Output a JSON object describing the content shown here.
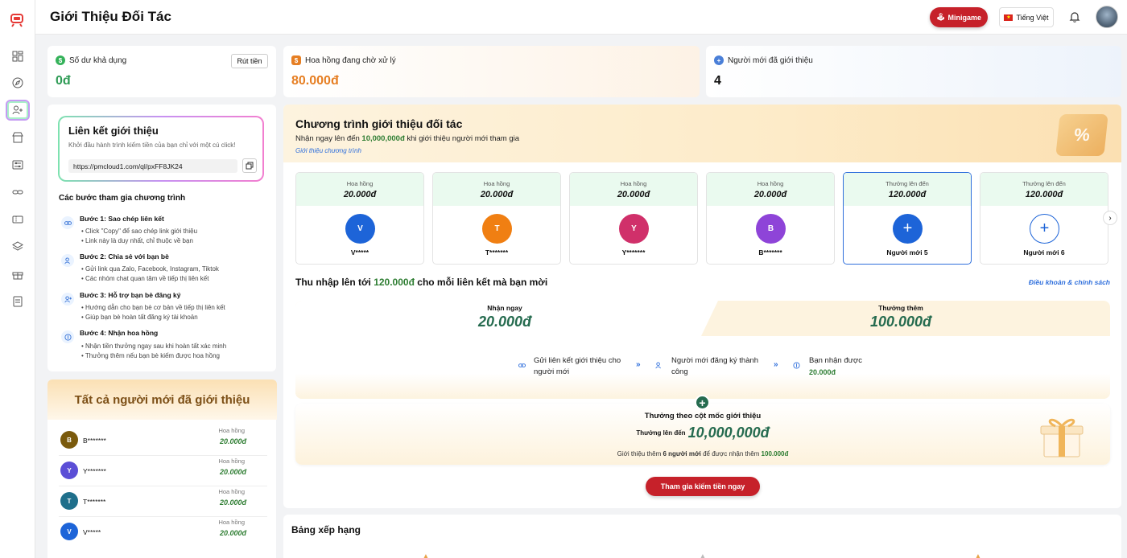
{
  "header": {
    "title": "Giới Thiệu Đối Tác",
    "minigame_label": "Minigame",
    "language_label": "Tiếng Việt"
  },
  "sidebar": {
    "items": [
      "dashboard-icon",
      "compass-icon",
      "user-plus-icon",
      "store-icon",
      "sliders-icon",
      "link-icon",
      "ticket-icon",
      "layers-icon",
      "gift-icon",
      "document-icon"
    ],
    "active_index": 2
  },
  "stats": {
    "balance": {
      "label": "Số dư khả dụng",
      "value": "0đ",
      "button": "Rút tiền"
    },
    "pending": {
      "label": "Hoa hồng đang chờ xử lý",
      "value": "80.000đ"
    },
    "referred": {
      "label": "Người mới đã giới thiệu",
      "value": "4"
    }
  },
  "referral": {
    "title": "Liên kết giới thiệu",
    "subtitle": "Khởi đầu hành trình kiếm tiền của bạn chỉ với một cú click!",
    "link": "https://pmcloud1.com/ql/pxFF8JK24"
  },
  "steps": {
    "title": "Các bước tham gia chương trình",
    "items": [
      {
        "title": "Bước 1: Sao chép liên kết",
        "lines": [
          "• Click \"Copy\" để sao chép link giới thiệu",
          "• Link này là duy nhất, chỉ thuộc về bạn"
        ]
      },
      {
        "title": "Bước 2: Chia sẻ với bạn bè",
        "lines": [
          "• Gửi link qua Zalo, Facebook, Instagram, Tiktok",
          "• Các nhóm chat quan tâm về tiếp thị liên kết"
        ]
      },
      {
        "title": "Bước 3: Hỗ trợ bạn bè đăng ký",
        "lines": [
          "• Hướng dẫn cho bạn bè cơ bản về tiếp thị liên kết",
          "• Giúp bạn bè hoàn tất đăng ký tài khoản"
        ]
      },
      {
        "title": "Bước 4: Nhận hoa hồng",
        "lines": [
          "• Nhận tiền thưởng ngay sau khi hoàn tất xác minh",
          "• Thưởng thêm nếu bạn bè kiếm được hoa hồng"
        ]
      }
    ]
  },
  "referred_list": {
    "title": "Tất cả người mới đã giới thiệu",
    "commission_label": "Hoa hồng",
    "rows": [
      {
        "initial": "B",
        "name": "B*******",
        "amount": "20.000đ",
        "color": "#7a5a0c"
      },
      {
        "initial": "Y",
        "name": "Y*******",
        "amount": "20.000đ",
        "color": "#5b4ed6"
      },
      {
        "initial": "T",
        "name": "T*******",
        "amount": "20.000đ",
        "color": "#1f6f8b"
      },
      {
        "initial": "V",
        "name": "V*****",
        "amount": "20.000đ",
        "color": "#1d64d8"
      }
    ]
  },
  "program": {
    "title": "Chương trình giới thiệu đối tác",
    "subtitle_prefix": "Nhận ngay lên đến",
    "subtitle_amount": "10,000,000đ",
    "subtitle_suffix": "khi giới thiệu người mới tham gia",
    "link": "Giới thiệu chương trình",
    "slots": [
      {
        "label": "Hoa hồng",
        "value": "20.000đ",
        "initial": "V",
        "name": "V*****",
        "color": "#1d64d8",
        "type": "user"
      },
      {
        "label": "Hoa hồng",
        "value": "20.000đ",
        "initial": "T",
        "name": "T*******",
        "color": "#f07f12",
        "type": "user"
      },
      {
        "label": "Hoa hồng",
        "value": "20.000đ",
        "initial": "Y",
        "name": "Y*******",
        "color": "#d0306a",
        "type": "user"
      },
      {
        "label": "Hoa hồng",
        "value": "20.000đ",
        "initial": "B",
        "name": "B*******",
        "color": "#8e44d8",
        "type": "user"
      },
      {
        "label": "Thưởng lên đến",
        "value": "120.000đ",
        "initial": "+",
        "name": "Người mới 5",
        "color": "#1d64d8",
        "type": "add-filled"
      },
      {
        "label": "Thưởng lên đến",
        "value": "120.000đ",
        "initial": "+",
        "name": "Người mới 6",
        "color": "#1d64d8",
        "type": "add-outline"
      }
    ],
    "earn_title_prefix": "Thu nhập lên tới",
    "earn_title_amount": "120.000đ",
    "earn_title_suffix": "cho mỗi liên kết mà bạn mời",
    "terms": "Điều khoản & chính sách",
    "instant_label": "Nhận ngay",
    "instant_value": "20.000đ",
    "bonus_label": "Thưởng thêm",
    "bonus_value": "100.000đ",
    "flow": {
      "step1": "Gửi liên kết giới thiệu cho người mới",
      "step2": "Người mới đăng ký thành công",
      "step3_title": "Bạn nhận được",
      "step3_value": "20.000đ"
    },
    "milestone": {
      "title": "Thưởng theo cột mốc giới thiệu",
      "up_to_label": "Thưởng lên đến",
      "up_to_value": "10,000,000đ",
      "note_prefix": "Giới thiệu thêm",
      "note_count": "6 người mới",
      "note_mid": "để được nhận thêm",
      "note_amount": "100.000đ"
    },
    "join_button": "Tham gia kiếm tiền ngay"
  },
  "ranking": {
    "title": "Bảng xếp hạng"
  },
  "colors": {
    "brand_red": "#c6212a",
    "green": "#2e7d32",
    "blue": "#2f6fdc"
  }
}
